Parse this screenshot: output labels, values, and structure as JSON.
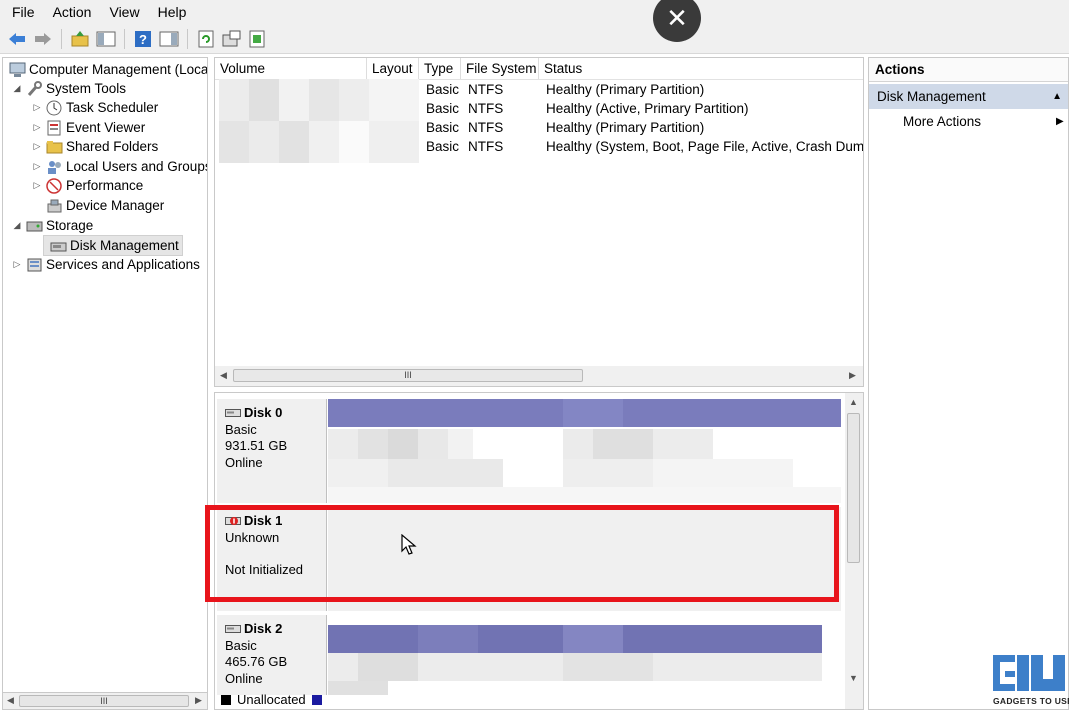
{
  "overlay": {
    "close_label": "✕"
  },
  "menubar": {
    "items": [
      "File",
      "Action",
      "View",
      "Help"
    ]
  },
  "toolbar": {
    "icons": [
      "back-arrow-icon",
      "forward-arrow-icon",
      "up-folder-icon",
      "show-hide-tree-icon",
      "help-icon",
      "console-pane-icon",
      "refresh-icon",
      "properties-icon",
      "export-icon"
    ]
  },
  "tree": {
    "root": "Computer Management (Local",
    "system_tools": "System Tools",
    "task_scheduler": "Task Scheduler",
    "event_viewer": "Event Viewer",
    "shared_folders": "Shared Folders",
    "local_users": "Local Users and Groups",
    "performance": "Performance",
    "device_manager": "Device Manager",
    "storage": "Storage",
    "disk_management": "Disk Management",
    "services": "Services and Applications",
    "scroll_thumb": "III"
  },
  "volume_list": {
    "columns": [
      "Volume",
      "Layout",
      "Type",
      "File System",
      "Status"
    ],
    "rows": [
      {
        "type": "Basic",
        "fs": "NTFS",
        "status": "Healthy (Primary Partition)"
      },
      {
        "type": "Basic",
        "fs": "NTFS",
        "status": "Healthy (Active, Primary Partition)"
      },
      {
        "type": "Basic",
        "fs": "NTFS",
        "status": "Healthy (Primary Partition)"
      },
      {
        "type": "Basic",
        "fs": "NTFS",
        "status": "Healthy (System, Boot, Page File, Active, Crash Dump, F"
      }
    ],
    "scroll_thumb": "III"
  },
  "disks": [
    {
      "name": "Disk 0",
      "type": "Basic",
      "size": "931.51 GB",
      "state": "Online"
    },
    {
      "name": "Disk 1",
      "type": "Unknown",
      "size": "",
      "state": "Not Initialized"
    },
    {
      "name": "Disk 2",
      "type": "Basic",
      "size": "465.76 GB",
      "state": "Online"
    }
  ],
  "legend": {
    "unallocated": "Unallocated"
  },
  "actions": {
    "title": "Actions",
    "section": "Disk Management",
    "more": "More Actions"
  },
  "watermark": {
    "text": "GADGETS TO USE"
  }
}
